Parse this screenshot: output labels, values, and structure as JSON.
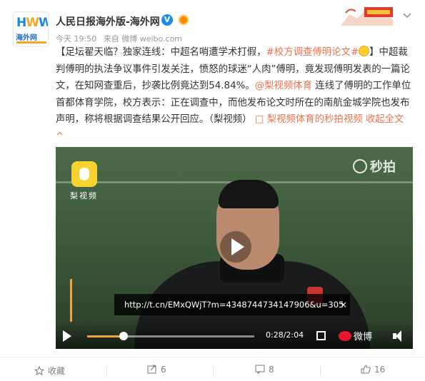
{
  "post": {
    "author": "人民日报海外版-海外网",
    "verified_icon": "verified-icon",
    "time": "今天 19:50",
    "source": "来自 微博 weibo.com",
    "text_parts": [
      "【足坛翟天临？独家连线：中超名哨遭学术打假，",
      "#校方调查傅明论文#",
      "】中超裁判傅明的执法争议事件引发关注，愤怒的球迷“人肉”傅明，竟发现傅明发表的一篇论文，在知网查重后，抄袭比例竟达到54.84%。",
      "@梨视频体育",
      " 连线了傅明的工作单位首都体育学院，校方表示：正在调查中，而他发布论文时所在的南航金城学院也发布声明，称将根据调查结果公开回应。（梨视频）",
      "梨视频体育的秒拍视频",
      "收起全文",
      "^"
    ]
  },
  "video": {
    "watermark_left": "梨视频",
    "watermark_right": "秒拍",
    "url_overlay": "http://t.cn/EMxQWjT?m=4348744734147906&u=305",
    "url_close": "×",
    "time_display": "0:28/2:04",
    "progress": 0.22,
    "logo_text": "微博"
  },
  "footer": {
    "favorite": "收藏",
    "repost_count": "6",
    "comment_count": "8",
    "like_count": "16"
  },
  "colors": {
    "accent": "#eb7350",
    "progress": "#f3a33a",
    "verified": "#1a8cec"
  }
}
